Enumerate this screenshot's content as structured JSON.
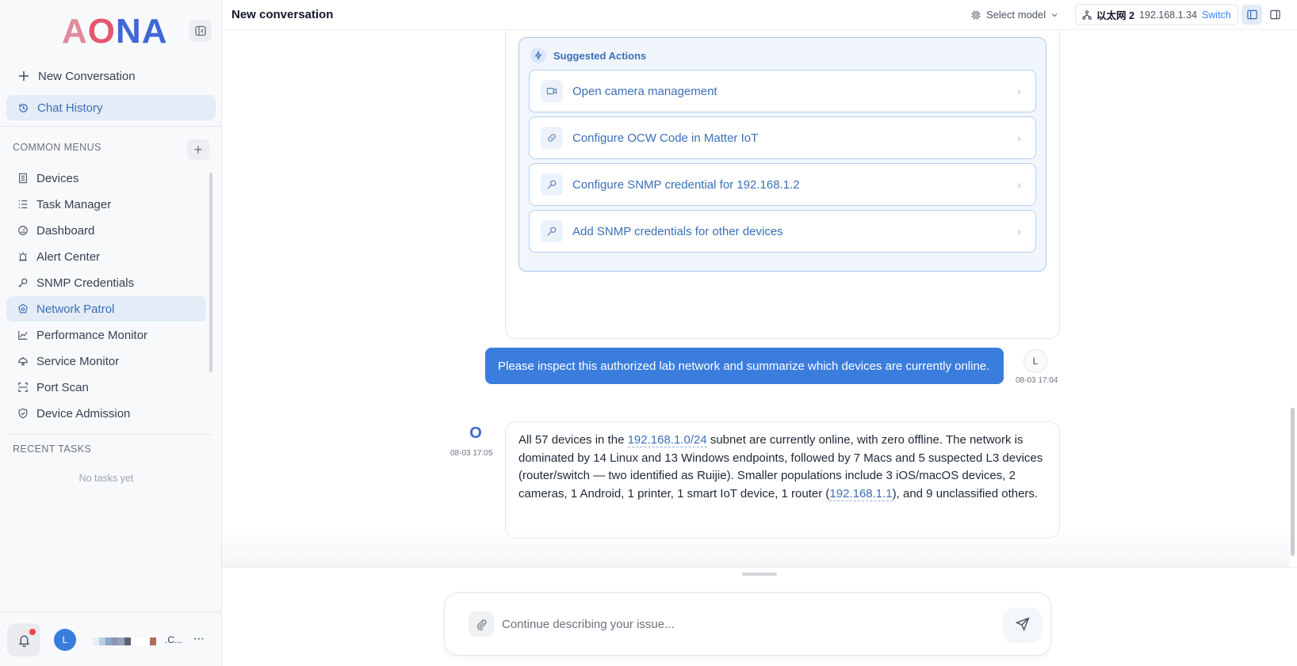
{
  "app": {
    "logo_text": "AONA"
  },
  "sidebar": {
    "new_conversation": "New Conversation",
    "chat_history": "Chat History",
    "common_menus_label": "COMMON MENUS",
    "add_menu_glyph": "+",
    "menu": [
      {
        "label": "Devices",
        "icon": "devices-icon",
        "active": false
      },
      {
        "label": "Task Manager",
        "icon": "task-list-icon",
        "active": false
      },
      {
        "label": "Dashboard",
        "icon": "dashboard-icon",
        "active": false
      },
      {
        "label": "Alert Center",
        "icon": "alert-icon",
        "active": false
      },
      {
        "label": "SNMP Credentials",
        "icon": "key-icon",
        "active": false
      },
      {
        "label": "Network Patrol",
        "icon": "patrol-icon",
        "active": true
      },
      {
        "label": "Performance Monitor",
        "icon": "chart-line-icon",
        "active": false
      },
      {
        "label": "Service Monitor",
        "icon": "service-icon",
        "active": false
      },
      {
        "label": "Port Scan",
        "icon": "scan-icon",
        "active": false
      },
      {
        "label": "Device Admission",
        "icon": "shield-check-icon",
        "active": false
      }
    ],
    "recent_tasks_label": "RECENT TASKS",
    "no_tasks": "No tasks yet",
    "user": {
      "avatar_initial": "L",
      "name_trail": ".C...",
      "more": "⋯"
    }
  },
  "header": {
    "title": "New conversation",
    "model_select": "Select model",
    "network_name": "以太网 2",
    "network_ip": "192.168.1.34",
    "switch_label": "Switch"
  },
  "chat": {
    "suggested_title": "Suggested Actions",
    "actions": [
      {
        "label": "Open camera management",
        "icon": "camera-icon"
      },
      {
        "label": "Configure OCW Code in Matter IoT",
        "icon": "link-icon"
      },
      {
        "label": "Configure SNMP credential for 192.168.1.2",
        "icon": "key-icon"
      },
      {
        "label": "Add SNMP credentials for other devices",
        "icon": "key-icon"
      }
    ],
    "user_message": "Please inspect this authorized lab network and summarize which devices are currently online.",
    "user_avatar": "L",
    "user_time": "08-03 17:04",
    "bot_avatar": "O",
    "bot_time": "08-03 17:05",
    "bot_reply": {
      "p1": "All 57 devices in the ",
      "link1": "192.168.1.0/24",
      "p2": " subnet are currently online, with zero offline. The network is dominated by 14 Linux and 13 Windows endpoints, followed by 7 Macs and 5 suspected L3 devices (router/switch — two identified as Ruijie). Smaller populations include 3 iOS/macOS devices, 2 cameras, 1 Android, 1 printer, 1 smart IoT device, 1 router (",
      "link2": "192.168.1.1",
      "p3": "), and 9 unclassified others."
    }
  },
  "composer": {
    "placeholder": "Continue describing your issue..."
  },
  "colors": {
    "accent": "#3b7ddd",
    "active_bg": "#e4ecf7",
    "link": "#3b6fb6",
    "notification_dot": "#ef4444"
  }
}
